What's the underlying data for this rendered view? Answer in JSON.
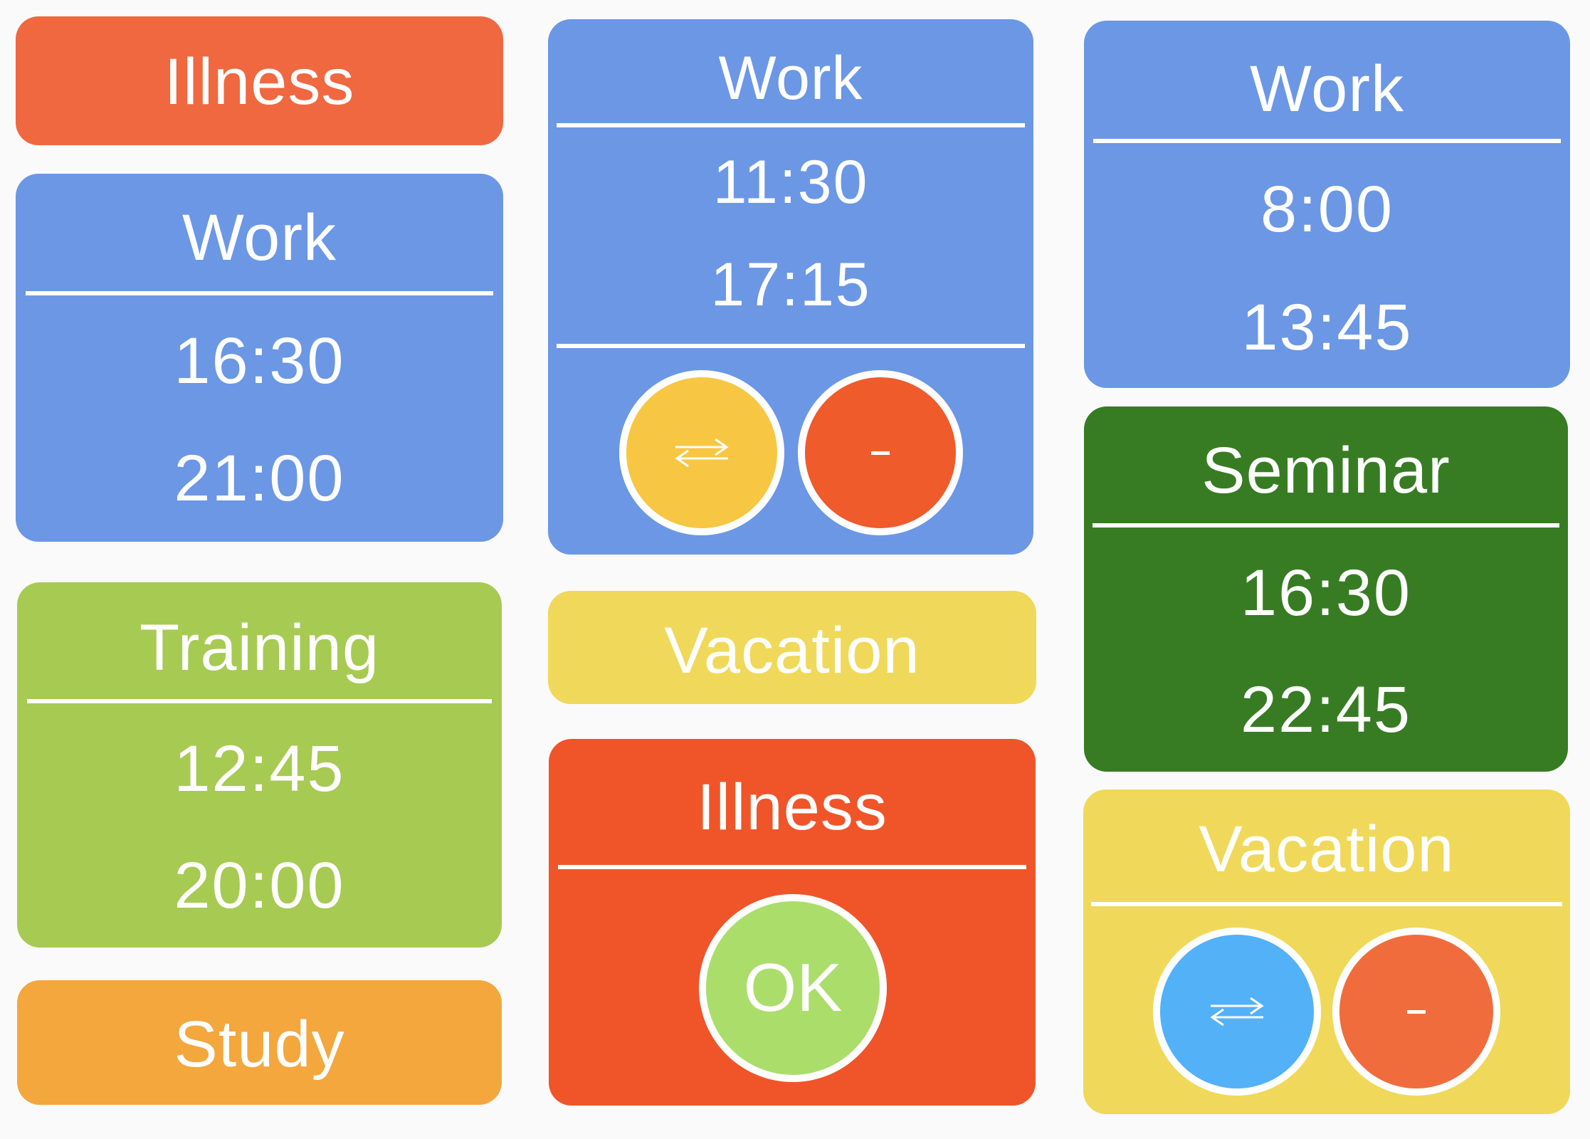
{
  "colors": {
    "work": "#6b97e5",
    "illness_light": "#f06840",
    "illness_dark": "#ef5529",
    "training": "#a7ca52",
    "study": "#f3a73d",
    "vacation": "#f0d95a",
    "seminar": "#377c23",
    "swap_yellow": "#f7c643",
    "swap_blue": "#53b1f7",
    "delete_orange": "#ef5b2b",
    "ok_green": "#abdd6b"
  },
  "column1": {
    "illness": {
      "label": "Illness"
    },
    "work": {
      "label": "Work",
      "start": "16:30",
      "end": "21:00"
    },
    "training": {
      "label": "Training",
      "start": "12:45",
      "end": "20:00"
    },
    "study": {
      "label": "Study"
    }
  },
  "column2": {
    "work": {
      "label": "Work",
      "start": "11:30",
      "end": "17:15",
      "actions": {
        "swap_icon": "swap-arrows-icon",
        "delete_label": "-"
      }
    },
    "vacation": {
      "label": "Vacation"
    },
    "illness": {
      "label": "Illness",
      "ok_label": "OK"
    }
  },
  "column3": {
    "work": {
      "label": "Work",
      "start": "8:00",
      "end": "13:45"
    },
    "seminar": {
      "label": "Seminar",
      "start": "16:30",
      "end": "22:45"
    },
    "vacation": {
      "label": "Vacation",
      "actions": {
        "swap_icon": "swap-arrows-icon",
        "delete_label": "-"
      }
    }
  }
}
